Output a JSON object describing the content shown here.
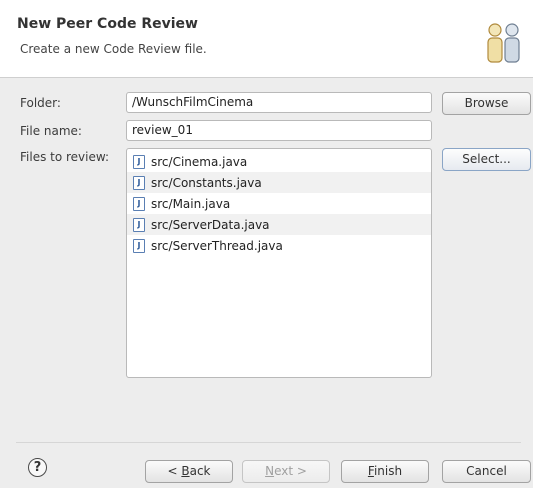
{
  "header": {
    "title": "New Peer Code Review",
    "description": "Create a new Code Review file."
  },
  "form": {
    "folder_label": "Folder:",
    "folder_value": "/WunschFilmCinema",
    "filename_label": "File name:",
    "filename_value": "review_01",
    "files_label": "Files to review:"
  },
  "buttons": {
    "browse": "Browse",
    "select": "Select..."
  },
  "files": [
    "src/Cinema.java",
    "src/Constants.java",
    "src/Main.java",
    "src/ServerData.java",
    "src/ServerThread.java"
  ],
  "footer": {
    "back_mnemonic": "B",
    "back_rest": "ack",
    "back_prefix": "< ",
    "next_mnemonic": "N",
    "next_rest": "ext >",
    "finish_mnemonic": "F",
    "finish_rest": "inish",
    "cancel": "Cancel",
    "help_glyph": "?"
  }
}
